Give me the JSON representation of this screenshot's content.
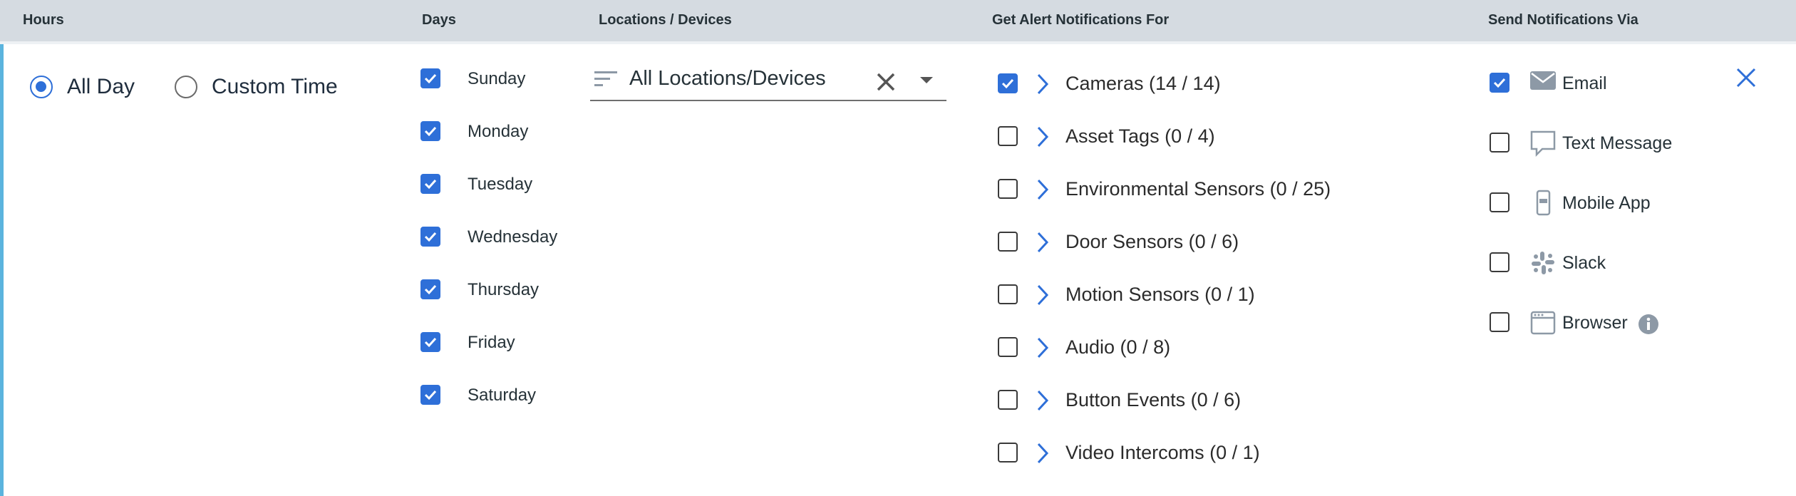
{
  "headers": {
    "hours": "Hours",
    "days": "Days",
    "locations": "Locations / Devices",
    "alerts": "Get Alert Notifications For",
    "via": "Send Notifications Via"
  },
  "hours": {
    "options": [
      {
        "label": "All Day",
        "selected": true
      },
      {
        "label": "Custom Time",
        "selected": false
      }
    ]
  },
  "days": [
    {
      "label": "Sunday",
      "checked": true
    },
    {
      "label": "Monday",
      "checked": true
    },
    {
      "label": "Tuesday",
      "checked": true
    },
    {
      "label": "Wednesday",
      "checked": true
    },
    {
      "label": "Thursday",
      "checked": true
    },
    {
      "label": "Friday",
      "checked": true
    },
    {
      "label": "Saturday",
      "checked": true
    }
  ],
  "locations": {
    "value": "All Locations/Devices"
  },
  "alerts": [
    {
      "label": "Cameras (14 / 14)",
      "checked": true
    },
    {
      "label": "Asset Tags (0 / 4)",
      "checked": false
    },
    {
      "label": "Environmental Sensors (0 / 25)",
      "checked": false
    },
    {
      "label": "Door Sensors (0 / 6)",
      "checked": false
    },
    {
      "label": "Motion Sensors (0 / 1)",
      "checked": false
    },
    {
      "label": "Audio (0 / 8)",
      "checked": false
    },
    {
      "label": "Button Events (0 / 6)",
      "checked": false
    },
    {
      "label": "Video Intercoms (0 / 1)",
      "checked": false
    }
  ],
  "via": [
    {
      "label": "Email",
      "checked": true,
      "icon": "email-icon"
    },
    {
      "label": "Text Message",
      "checked": false,
      "icon": "message-icon"
    },
    {
      "label": "Mobile App",
      "checked": false,
      "icon": "mobile-icon"
    },
    {
      "label": "Slack",
      "checked": false,
      "icon": "slack-icon"
    },
    {
      "label": "Browser",
      "checked": false,
      "icon": "browser-icon",
      "info": true
    }
  ],
  "colors": {
    "accent": "#2e6fd8",
    "header_bg": "#d5dbe1",
    "left_bar": "#5bb4de",
    "icon_gray": "#8d99a6"
  }
}
